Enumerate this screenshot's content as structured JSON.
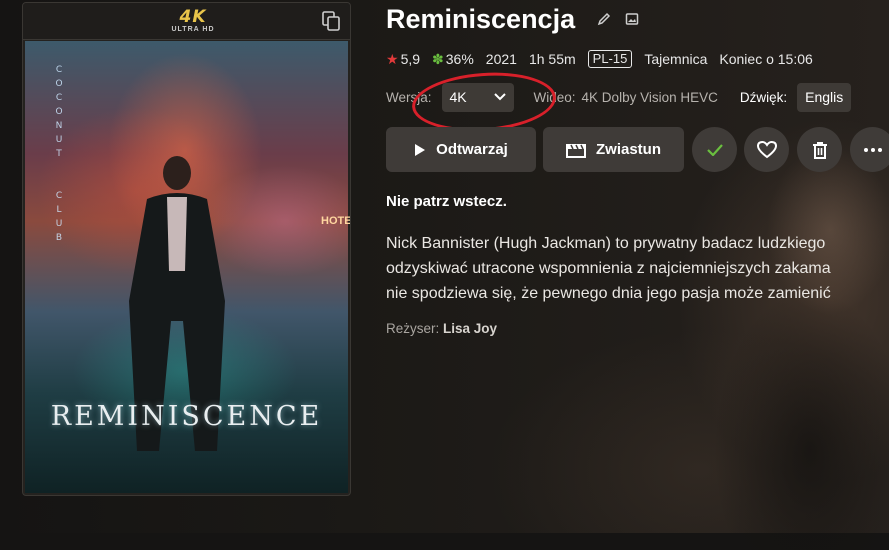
{
  "poster": {
    "badge_big": "4K",
    "badge_small": "ULTRA HD",
    "neon_sign": "COCONUT CLUB",
    "hotel_sign": "HOTE",
    "title_art": "REMINISCENCE"
  },
  "title": "Reminiscencja",
  "meta": {
    "rating": "5,9",
    "audience": "36%",
    "year": "2021",
    "runtime": "1h 55m",
    "content_rating": "PL-15",
    "genre": "Tajemnica",
    "ends_at": "Koniec o 15:06"
  },
  "version": {
    "label": "Wersja:",
    "value": "4K",
    "video_label": "Wideo:",
    "video_value": "4K Dolby Vision HEVC",
    "audio_label": "Dźwięk:",
    "audio_value": "Englis"
  },
  "actions": {
    "play": "Odtwarzaj",
    "trailer": "Zwiastun"
  },
  "tagline": "Nie patrz wstecz.",
  "overview": [
    "Nick Bannister (Hugh Jackman) to prywatny badacz ludzkiego",
    "odzyskiwać utracone wspomnienia z najciemniejszych zakama",
    "nie spodziewa się, że pewnego dnia jego pasja może zamienić"
  ],
  "director": {
    "label": "Reżyser:",
    "name": "Lisa Joy"
  },
  "colors": {
    "accent_check": "#6abf3f",
    "star": "#e23a3a",
    "annotation": "#d8202a"
  }
}
